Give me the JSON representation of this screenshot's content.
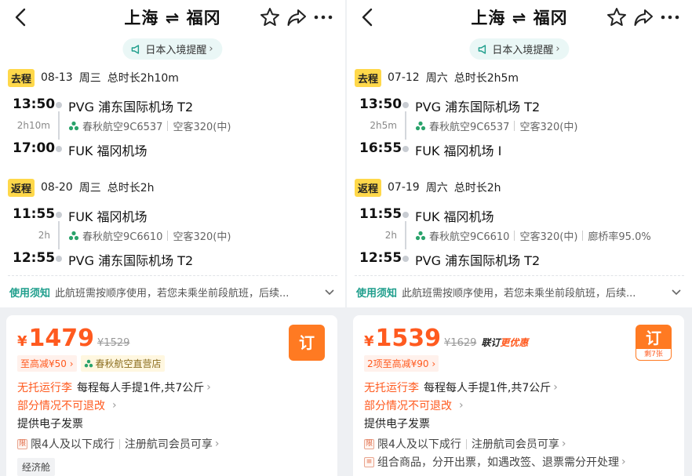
{
  "panels": [
    {
      "title": "上海 ⇌ 福冈",
      "notice": "日本入境提醒",
      "outbound": {
        "tag": "去程",
        "date": "08-13",
        "weekday": "周三",
        "duration_total": "总时长2h10m",
        "dep_time": "13:50",
        "dep_airport": "PVG 浦东国际机场 T2",
        "duration": "2h10m",
        "flight": "春秋航空9C6537",
        "aircraft": "空客320(中)",
        "extra": "",
        "arr_time": "17:00",
        "arr_airport": "FUK 福冈机场"
      },
      "return": {
        "tag": "返程",
        "date": "08-20",
        "weekday": "周三",
        "duration_total": "总时长2h",
        "dep_time": "11:55",
        "dep_airport": "FUK 福冈机场",
        "duration": "2h",
        "flight": "春秋航空9C6610",
        "aircraft": "空客320(中)",
        "extra": "",
        "arr_time": "12:55",
        "arr_airport": "PVG 浦东国际机场 T2"
      },
      "usage_title": "使用须知",
      "usage_desc": "此航班需按顺序使用，若您未乘坐前段航班，后续...",
      "offer": {
        "currency": "¥",
        "price": "1479",
        "original_price": "¥1529",
        "lianding": "",
        "lianding_hl": "",
        "discount_tag": "至高减¥50",
        "store_tag": "春秋航空直营店",
        "book_label": "订",
        "tickets_left": "",
        "baggage_red": "无托运行李",
        "baggage_text": "每程每人手提1件,共7公斤",
        "refund_red": "部分情况不可退改",
        "invoice": "提供电子发票",
        "limit_icon": "限",
        "limit_text": "限4人及以下成行",
        "member_text": "注册航司会员可享",
        "combo_icon": "",
        "combo_text": "",
        "cabin": "经济舱"
      }
    },
    {
      "title": "上海 ⇌ 福冈",
      "notice": "日本入境提醒",
      "outbound": {
        "tag": "去程",
        "date": "07-12",
        "weekday": "周六",
        "duration_total": "总时长2h5m",
        "dep_time": "13:50",
        "dep_airport": "PVG 浦东国际机场 T2",
        "duration": "2h5m",
        "flight": "春秋航空9C6537",
        "aircraft": "空客320(中)",
        "extra": "",
        "arr_time": "16:55",
        "arr_airport": "FUK 福冈机场 I"
      },
      "return": {
        "tag": "返程",
        "date": "07-19",
        "weekday": "周六",
        "duration_total": "总时长2h",
        "dep_time": "11:55",
        "dep_airport": "FUK 福冈机场",
        "duration": "2h",
        "flight": "春秋航空9C6610",
        "aircraft": "空客320(中)",
        "extra": "廊桥率95.0%",
        "arr_time": "12:55",
        "arr_airport": "PVG 浦东国际机场 T2"
      },
      "usage_title": "使用须知",
      "usage_desc": "此航班需按顺序使用，若您未乘坐前段航班，后续...",
      "offer": {
        "currency": "¥",
        "price": "1539",
        "original_price": "¥1629",
        "lianding": "联订",
        "lianding_hl": "更优惠",
        "discount_tag": "2项至高减¥90",
        "store_tag": "",
        "book_label": "订",
        "tickets_left": "剩7张",
        "baggage_red": "无托运行李",
        "baggage_text": "每程每人手提1件,共7公斤",
        "refund_red": "部分情况不可退改",
        "invoice": "提供电子发票",
        "limit_icon": "限",
        "limit_text": "限4人及以下成行",
        "member_text": "注册航司会员可享",
        "combo_icon": "≡",
        "combo_text": "组合商品，分开出票，如遇改签、退票需分开处理",
        "cabin": ""
      }
    }
  ],
  "colors": {
    "accent": "#ff5a1f",
    "teal": "#1f9e8c",
    "tag_yellow": "#ffd84a",
    "book_orange": "#ff7a22"
  }
}
